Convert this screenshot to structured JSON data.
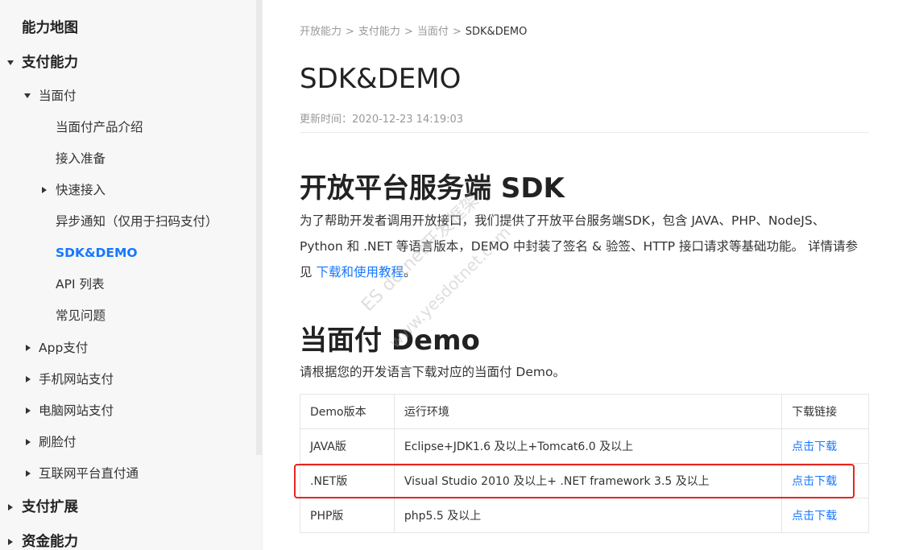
{
  "sidebar": {
    "items": [
      {
        "label": "能力地图"
      },
      {
        "label": "支付能力"
      },
      {
        "label": "当面付"
      },
      {
        "label": "当面付产品介绍"
      },
      {
        "label": "接入准备"
      },
      {
        "label": "快速接入"
      },
      {
        "label": "异步通知（仅用于扫码支付）"
      },
      {
        "label": "SDK&DEMO"
      },
      {
        "label": "API 列表"
      },
      {
        "label": "常见问题"
      },
      {
        "label": "App支付"
      },
      {
        "label": "手机网站支付"
      },
      {
        "label": "电脑网站支付"
      },
      {
        "label": "刷脸付"
      },
      {
        "label": "互联网平台直付通"
      },
      {
        "label": "支付扩展"
      },
      {
        "label": "资金能力"
      }
    ]
  },
  "breadcrumb": [
    "开放能力",
    "支付能力",
    "当面付",
    "SDK&DEMO"
  ],
  "breadcrumb_sep": ">",
  "page_title": "SDK&DEMO",
  "update_time": "更新时间：2020-12-23 14:19:03",
  "sdk_section": {
    "title": "开放平台服务端 SDK",
    "para_line1": "为了帮助开发者调用开放接口，我们提供了开放平台服务端SDK，包含 JAVA、PHP、NodeJS、",
    "para_line2": "Python 和 .NET 等语言版本，DEMO 中封装了签名 & 验签、HTTP 接口请求等基础功能。 详情请参",
    "para_line3_prefix": "见 ",
    "para_link": "下载和使用教程",
    "para_line3_suffix": "。"
  },
  "demo_section": {
    "title": "当面付 Demo",
    "intro": "请根据您的开发语言下载对应的当面付 Demo。",
    "table": {
      "headers": [
        "Demo版本",
        "运行环境",
        "下载链接"
      ],
      "rows": [
        {
          "version": "JAVA版",
          "env": "Eclipse+JDK1.6 及以上+Tomcat6.0 及以上",
          "download": "点击下载"
        },
        {
          "version": ".NET版",
          "env": "Visual Studio 2010 及以上+ .NET framework 3.5 及以上",
          "download": "点击下载"
        },
        {
          "version": "PHP版",
          "env": "php5.5 及以上",
          "download": "点击下载"
        }
      ]
    }
  },
  "watermark": {
    "line1": "ES dotnet开发框架",
    "line2": "www.yesdotnet.com"
  },
  "colors": {
    "accent": "#1677ff",
    "highlight_box": "#e8241f",
    "sidebar_bg": "#f7f7f7"
  }
}
